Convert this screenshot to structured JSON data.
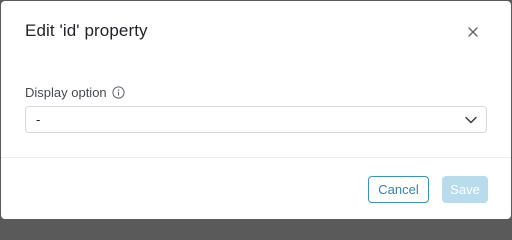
{
  "dialog": {
    "title": "Edit 'id' property",
    "close_icon": "close-icon"
  },
  "field": {
    "label": "Display option",
    "info_icon": "info-icon",
    "selected_value": "-",
    "dropdown_icon": "chevron-down-icon"
  },
  "footer": {
    "cancel_label": "Cancel",
    "save_label": "Save",
    "save_enabled": false
  },
  "colors": {
    "accent": "#3a93b8",
    "save_disabled_bg": "#b8dceb",
    "backdrop": "#5a5a5a"
  }
}
